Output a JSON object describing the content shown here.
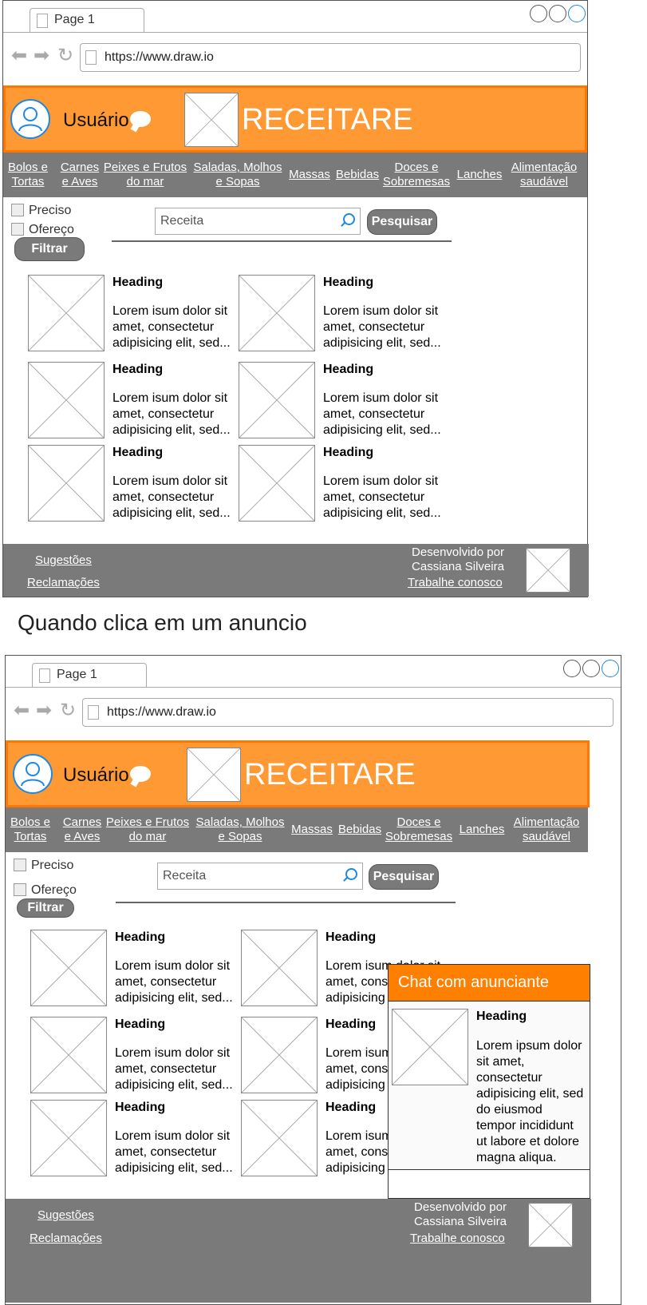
{
  "browser": {
    "tab_label": "Page 1",
    "url": "https://www.draw.io"
  },
  "header": {
    "user_label": "Usuário",
    "logo_text": "RECEITARE"
  },
  "nav": {
    "items": [
      "Bolos e Tortas",
      "Carnes e Aves",
      "Peixes e Frutos do mar",
      "Saladas, Molhos e Sopas",
      "Massas",
      "Bebidas",
      "Doces e Sobremesas",
      "Lanches",
      "Alimentação saudável"
    ],
    "lines": [
      [
        "Bolos e",
        "Tortas"
      ],
      [
        "Carnes",
        "e Aves"
      ],
      [
        "Peixes e Frutos",
        "do mar"
      ],
      [
        "Saladas, Molhos",
        "e Sopas"
      ],
      [
        "Massas"
      ],
      [
        "Bebidas"
      ],
      [
        "Doces e",
        "Sobremesas"
      ],
      [
        "Lanches"
      ],
      [
        "Alimentação",
        "saudável"
      ]
    ]
  },
  "filters": {
    "preciso": "Preciso",
    "ofereco": "Ofereço",
    "filter_button": "Filtrar"
  },
  "search": {
    "placeholder": "Receita",
    "button": "Pesquisar"
  },
  "card": {
    "heading": "Heading",
    "text": "Lorem isum dolor sit amet, consectetur adipisicing elit, sed..."
  },
  "footer": {
    "sugestoes": "Sugestões",
    "reclamacoes": "Reclamações",
    "developed_by": "Desenvolvido por Cassiana Silveira",
    "trabalhe": "Trabalhe conosco"
  },
  "caption": "Quando clica em um anuncio",
  "chat": {
    "title": "Chat com anunciante",
    "heading": "Heading",
    "text": "Lorem ipsum dolor sit amet, consectetur adipisicing elit, sed do eiusmod tempor incididunt ut labore et dolore magna aliqua."
  },
  "colors": {
    "header_orange": "#ff9933",
    "header_border": "#ff7700",
    "nav_gray": "#7a7a7a",
    "chat_orange": "#ff7f00",
    "accent_blue": "#1e88e5"
  },
  "icons": [
    "page-icon",
    "back-arrow-icon",
    "forward-arrow-icon",
    "reload-icon",
    "user-avatar-icon",
    "chat-bubble-icon",
    "search-icon",
    "image-placeholder-icon",
    "window-control-icon"
  ]
}
